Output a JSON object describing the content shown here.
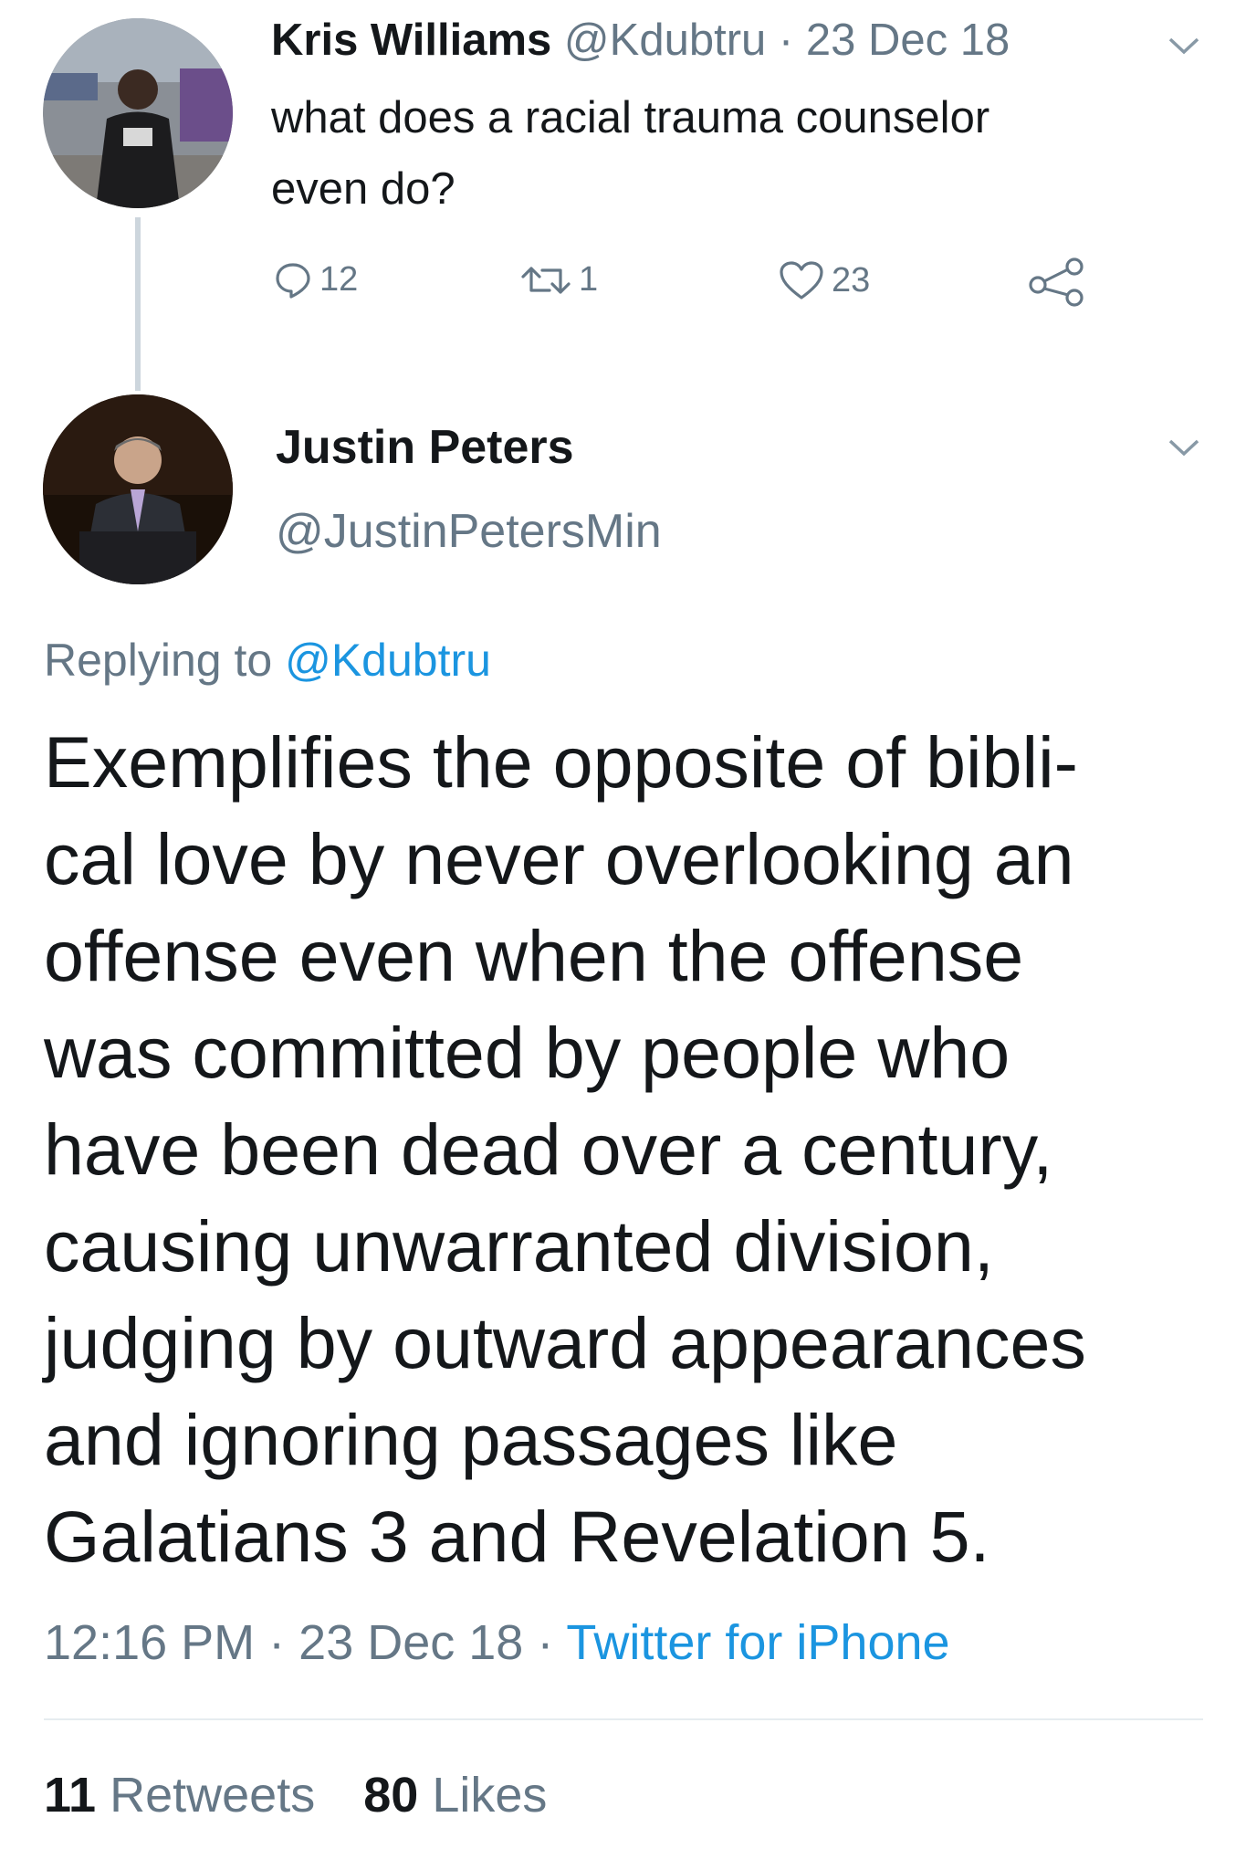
{
  "parent_tweet": {
    "author_name": "Kris Williams",
    "handle": "@Kdubtru",
    "separator": "·",
    "date": "23 Dec 18",
    "text_line1": "what does a racial trauma counselor",
    "text_line2": "even do?",
    "replies": "12",
    "retweets": "1",
    "likes": "23"
  },
  "main_tweet": {
    "author_name": "Justin Peters",
    "handle": "@JustinPetersMin",
    "replying_prefix": "Replying to",
    "replying_to": "@Kdubtru",
    "text_lines": [
      "Exemplifies the opposite of bibli-",
      "cal love by never overlooking an",
      "offense even when the offense",
      "was committed by people who",
      "have been dead over a century,",
      "causing unwarranted division,",
      "judging by outward appearances",
      "and ignoring passages like",
      "Galatians 3 and Revelation 5."
    ],
    "time": "12:16 PM",
    "date": "23 Dec 18",
    "separator": "·",
    "source": "Twitter for iPhone",
    "retweet_count": "11",
    "retweet_label": "Retweets",
    "like_count": "80",
    "like_label": "Likes"
  },
  "colors": {
    "link": "#1b95e0",
    "muted": "#657786",
    "text": "#14171a",
    "thread_line": "#cdd6dd"
  },
  "icons": [
    "reply-icon",
    "retweet-icon",
    "like-icon",
    "share-icon",
    "chevron-down-icon"
  ]
}
